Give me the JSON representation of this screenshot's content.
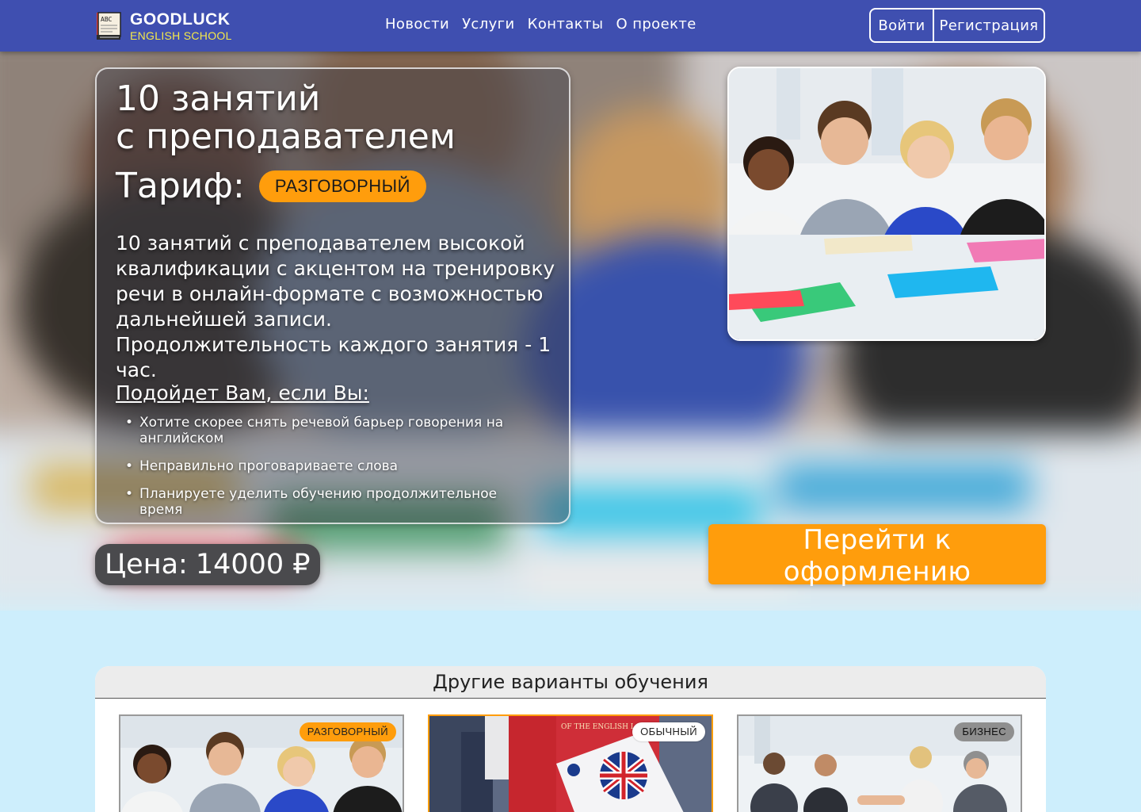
{
  "header": {
    "logo": {
      "book_text": "ABC",
      "title": "GOODLUCK",
      "subtitle": "ENGLISH SCHOOL"
    },
    "nav": [
      {
        "label": "Новости"
      },
      {
        "label": "Услуги"
      },
      {
        "label": "Контакты"
      },
      {
        "label": "О проекте"
      }
    ],
    "auth": {
      "login": "Войти",
      "register": "Регистрация"
    }
  },
  "hero": {
    "title_line1": "10 занятий",
    "title_line2": "с преподавателем",
    "tariff_label": "Тариф:",
    "tariff_badge": "РАЗГОВОРНЫЙ",
    "description": "10 занятий с преподавателем высокой квалификации с акцентом на тренировку речи в онлайн-формате с возможностью дальнейшей записи.",
    "duration": "Продолжительность каждого занятия - 1 час.",
    "fit_title": "Подойдет Вам, если Вы:",
    "fit_items": [
      "Хотите скорее снять речевой барьер говорения на английском",
      "Неправильно проговариваете слова",
      "Планируете уделить обучению продолжительное время"
    ],
    "price_label": "Цена:",
    "price_value": "14000 ₽",
    "cta": "Перейти к оформлению"
  },
  "others": {
    "title": "Другие варианты обучения",
    "cards": [
      {
        "badge": "РАЗГОВОРНЫЙ",
        "image": "students-photo"
      },
      {
        "badge": "ОБЫЧНЫЙ",
        "image": "dictionary-photo",
        "image_text": "OF THE ENGLISH LANGUAGE"
      },
      {
        "badge": "БИЗНЕС",
        "image": "business-handshake-photo"
      }
    ]
  },
  "colors": {
    "header": "#3f4fb0",
    "accent": "#ff9d0c",
    "logo_sub": "#f5e94a",
    "page_bg": "#cdeefc"
  }
}
